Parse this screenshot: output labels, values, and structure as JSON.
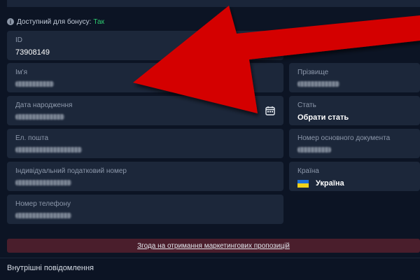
{
  "bonus": {
    "label": "Доступний для бонусу:",
    "value": "Так",
    "value_color": "#2ecc71"
  },
  "fields": {
    "id": {
      "label": "ID",
      "value": "73908149"
    },
    "first_name": {
      "label": "Ім'я",
      "value": ""
    },
    "last_name": {
      "label": "Прізвище",
      "value": ""
    },
    "birth_date": {
      "label": "Дата народження",
      "value": ""
    },
    "gender": {
      "label": "Стать",
      "value": "Обрати стать"
    },
    "email": {
      "label": "Ел. пошта",
      "value": ""
    },
    "document": {
      "label": "Номер основного документа",
      "value": ""
    },
    "tax_id": {
      "label": "Індивідуальний податковий номер",
      "value": ""
    },
    "country": {
      "label": "Країна",
      "value": "Україна"
    },
    "phone": {
      "label": "Номер телефону",
      "value": ""
    }
  },
  "consent_link": "Згода на отримання маркетингових пропозицій",
  "section_title": "Внутрішні повідомлення",
  "icons": {
    "info": "info-icon",
    "calendar": "calendar-icon",
    "flag": "ukraine-flag-icon",
    "arrow": "red-arrow-annotation"
  },
  "colors": {
    "background": "#0c1424",
    "field_bg": "#1c273a",
    "consent_bg": "#4a1e2c",
    "arrow": "#d40000"
  }
}
